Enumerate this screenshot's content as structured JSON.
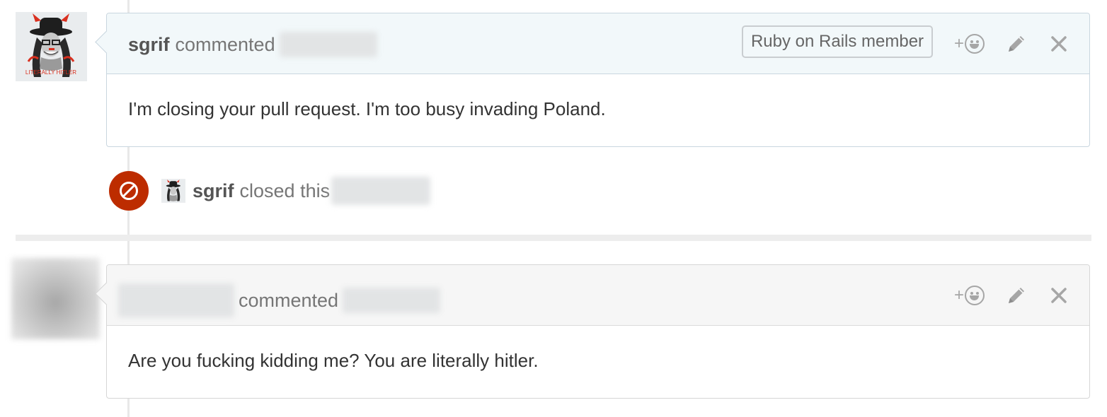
{
  "comment1": {
    "author": "sgrif",
    "action": "commented",
    "badge": "Ruby on Rails member",
    "reaction_plus": "+",
    "body": "I'm closing your pull request. I'm too busy invading Poland.",
    "avatar_caption": "LITERALLY HITLER"
  },
  "event": {
    "author": "sgrif",
    "action": "closed this",
    "badge_color": "#bd2c00"
  },
  "comment2": {
    "action": "commented",
    "reaction_plus": "+",
    "body": "Are you fucking kidding me? You are literally hitler."
  },
  "icons": {
    "reaction": "smiley-icon",
    "edit": "pencil-icon",
    "delete": "close-icon",
    "closed": "circle-slash-icon"
  }
}
